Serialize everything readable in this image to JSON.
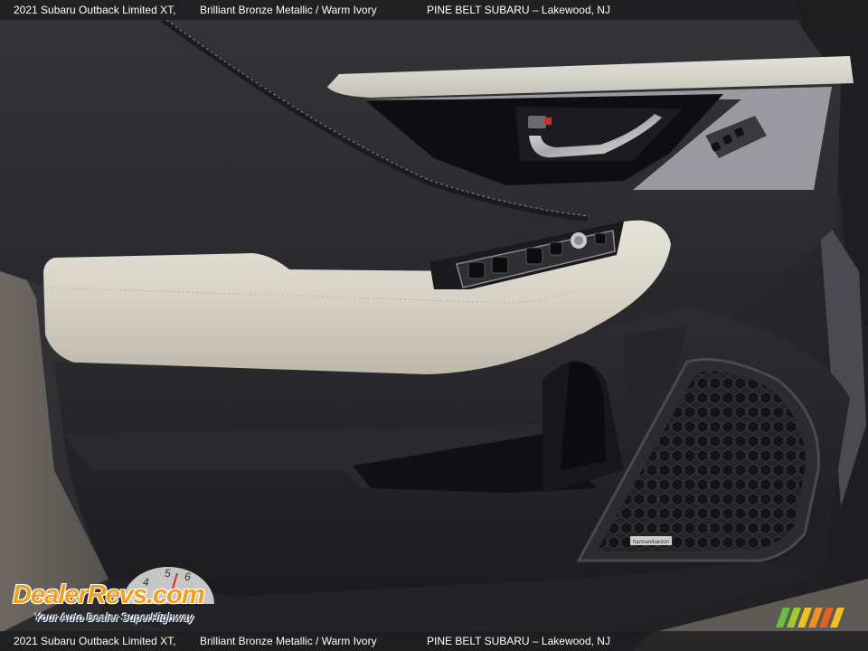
{
  "caption": {
    "model": "2021 Subaru Outback Limited XT,",
    "color": "Brilliant Bronze Metallic / Warm Ivory",
    "dealer": "PINE BELT SUBARU – Lakewood, NJ"
  },
  "watermark": {
    "brand": "DealerRevs.com",
    "tagline": "Your Auto Dealer SuperHighway",
    "gauge_digits": [
      "4",
      "5",
      "6"
    ]
  },
  "speaker_badge": "harman/kardon",
  "icons": [
    "door-handle-icon",
    "power-window-switch-icon",
    "speaker-grille-icon",
    "gauge-icon",
    "stripes-logo-icon"
  ]
}
